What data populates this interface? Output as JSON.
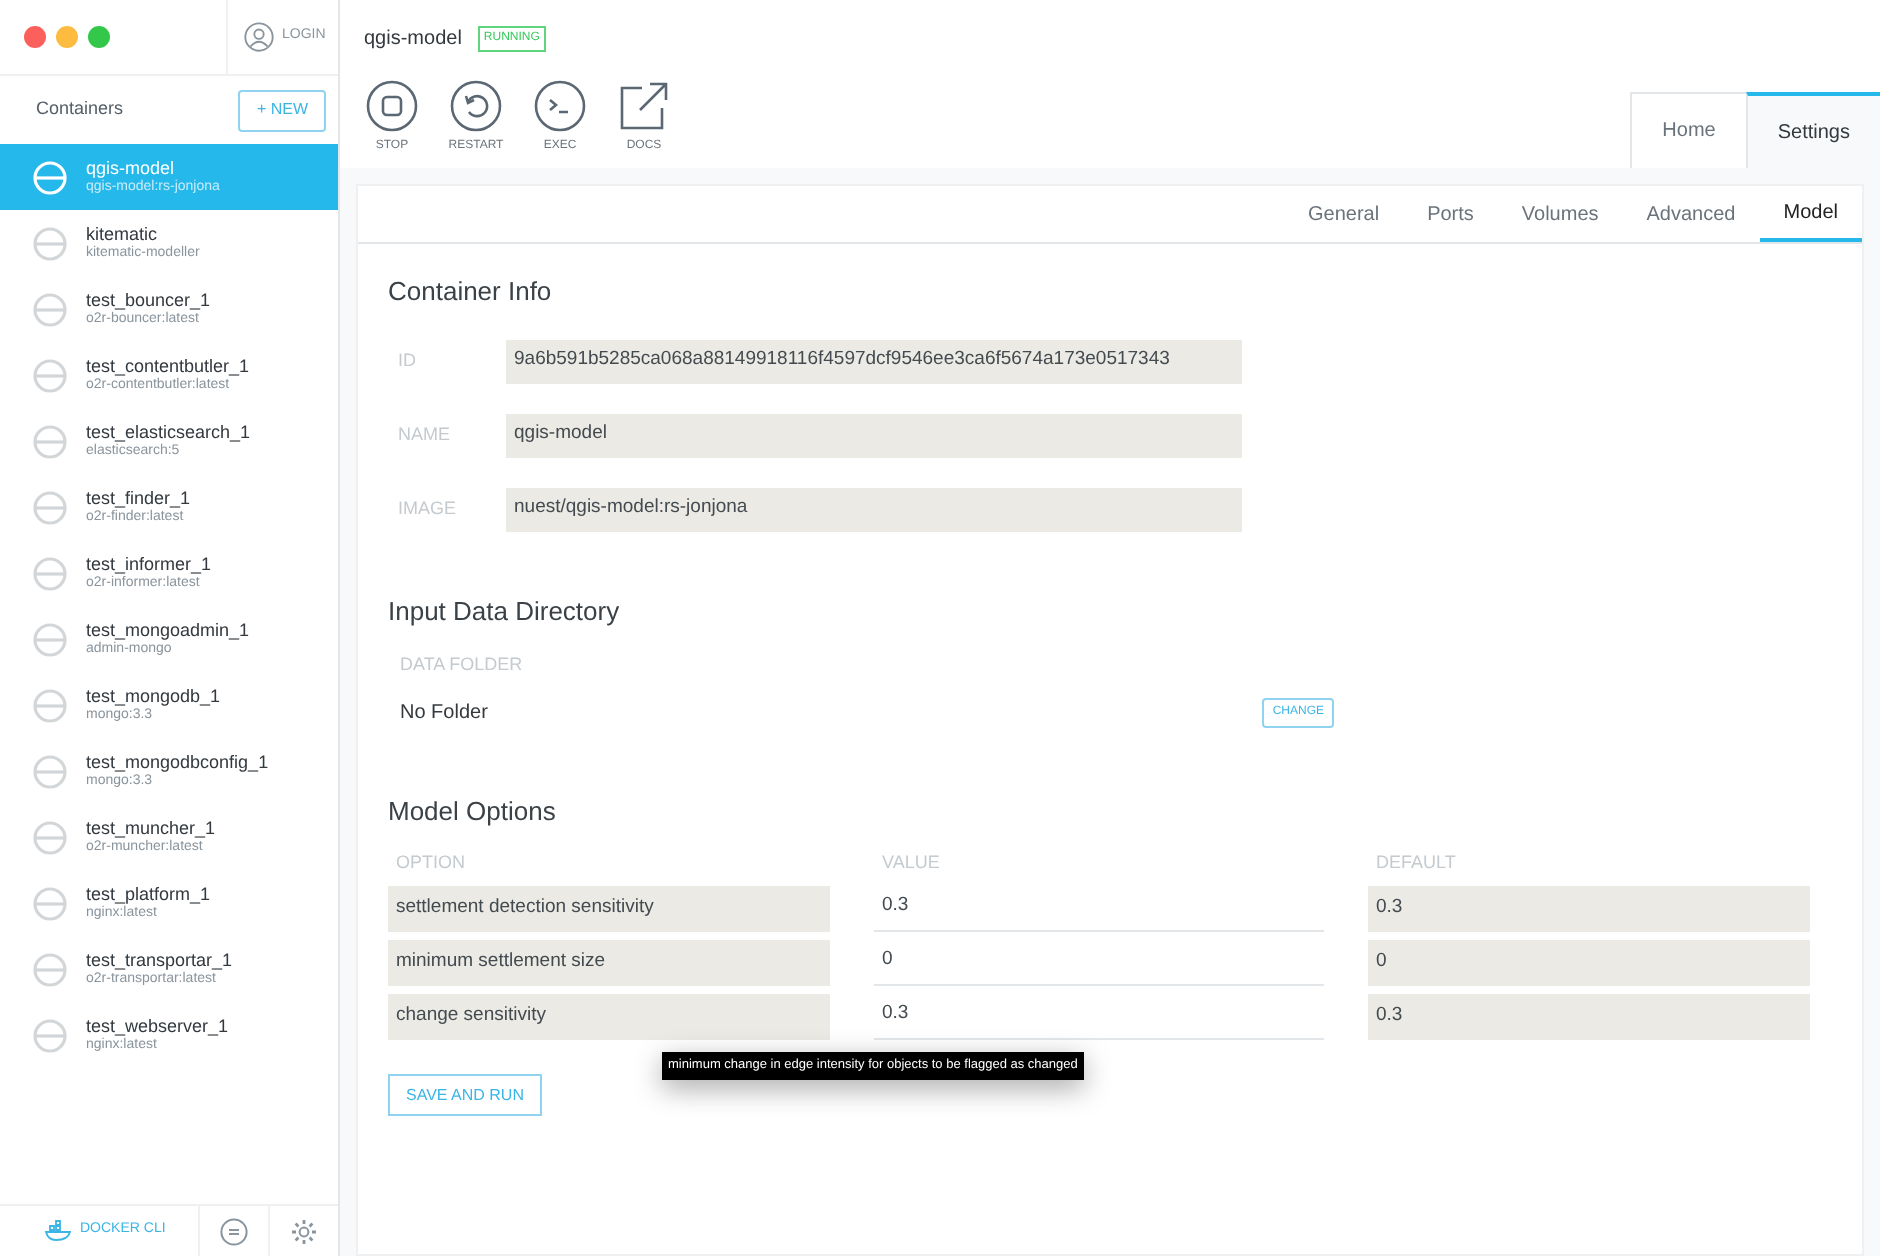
{
  "sidebar": {
    "login": "LOGIN",
    "title": "Containers",
    "new_button": "+ NEW",
    "containers": [
      {
        "name": "qgis-model",
        "image": "qgis-model:rs-jonjona",
        "selected": true
      },
      {
        "name": "kitematic",
        "image": "kitematic-modeller",
        "selected": false
      },
      {
        "name": "test_bouncer_1",
        "image": "o2r-bouncer:latest",
        "selected": false
      },
      {
        "name": "test_contentbutler_1",
        "image": "o2r-contentbutler:latest",
        "selected": false
      },
      {
        "name": "test_elasticsearch_1",
        "image": "elasticsearch:5",
        "selected": false
      },
      {
        "name": "test_finder_1",
        "image": "o2r-finder:latest",
        "selected": false
      },
      {
        "name": "test_informer_1",
        "image": "o2r-informer:latest",
        "selected": false
      },
      {
        "name": "test_mongoadmin_1",
        "image": "admin-mongo",
        "selected": false
      },
      {
        "name": "test_mongodb_1",
        "image": "mongo:3.3",
        "selected": false
      },
      {
        "name": "test_mongodbconfig_1",
        "image": "mongo:3.3",
        "selected": false
      },
      {
        "name": "test_muncher_1",
        "image": "o2r-muncher:latest",
        "selected": false
      },
      {
        "name": "test_platform_1",
        "image": "nginx:latest",
        "selected": false
      },
      {
        "name": "test_transportar_1",
        "image": "o2r-transportar:latest",
        "selected": false
      },
      {
        "name": "test_webserver_1",
        "image": "nginx:latest",
        "selected": false
      }
    ],
    "footer": {
      "docker_cli": "DOCKER CLI"
    }
  },
  "header": {
    "title": "qgis-model",
    "status": "RUNNING",
    "actions": [
      {
        "kind": "stop",
        "label": "STOP"
      },
      {
        "kind": "restart",
        "label": "RESTART"
      },
      {
        "kind": "exec",
        "label": "EXEC"
      },
      {
        "kind": "docs",
        "label": "DOCS"
      }
    ],
    "tabs": [
      {
        "label": "Home",
        "selected": false
      },
      {
        "label": "Settings",
        "selected": true
      }
    ]
  },
  "subtabs": [
    {
      "label": "General",
      "selected": false
    },
    {
      "label": "Ports",
      "selected": false
    },
    {
      "label": "Volumes",
      "selected": false
    },
    {
      "label": "Advanced",
      "selected": false
    },
    {
      "label": "Model",
      "selected": true
    }
  ],
  "container_info": {
    "title": "Container Info",
    "fields": [
      {
        "label": "ID",
        "value": "9a6b591b5285ca068a88149918116f4597dcf9546ee3ca6f5674a173e0517343"
      },
      {
        "label": "NAME",
        "value": "qgis-model"
      },
      {
        "label": "IMAGE",
        "value": "nuest/qgis-model:rs-jonjona"
      }
    ]
  },
  "input_data": {
    "title": "Input Data Directory",
    "label": "DATA FOLDER",
    "value": "No Folder",
    "button": "CHANGE"
  },
  "model_options": {
    "title": "Model Options",
    "columns": [
      "OPTION",
      "VALUE",
      "DEFAULT"
    ],
    "rows": [
      {
        "option": "settlement detection sensitivity",
        "value": "0.3",
        "default": "0.3"
      },
      {
        "option": "minimum settlement size",
        "value": "0",
        "default": "0"
      },
      {
        "option": "change sensitivity",
        "value": "0.3",
        "default": "0.3"
      }
    ],
    "tooltip": "minimum change in edge intensity for objects to be flagged as changed",
    "button": "SAVE AND RUN"
  }
}
